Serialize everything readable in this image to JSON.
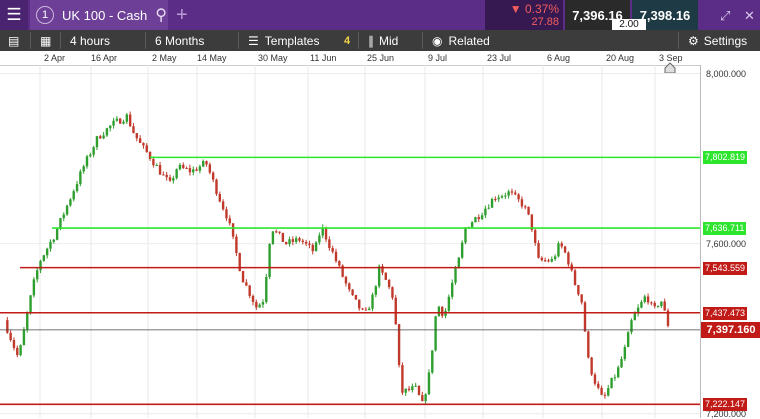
{
  "instrument": {
    "tab_number": "1",
    "name": "UK 100 - Cash"
  },
  "quote": {
    "change_pct": "▼ 0.37%",
    "change_abs": "27.88",
    "sell": "7,396.16",
    "buy": "7,398.16",
    "spread": "2.00"
  },
  "toolbar": {
    "interval": "4 hours",
    "range": "6 Months",
    "templates": "Templates",
    "templates_count": "4",
    "price_type": "Mid",
    "related": "Related",
    "settings": "Settings"
  },
  "icons": {
    "menu": "hamburger-icon",
    "search": "search-icon",
    "add": "plus-icon",
    "minimize": "minimize-icon",
    "close": "close-icon",
    "expand": "expand-icon"
  },
  "colors": {
    "header": "#5b2d86",
    "support": "#2ecc40",
    "resistance": "#c11b17",
    "bull": "#2e9e2e",
    "bear": "#c0392b"
  },
  "chart_data": {
    "type": "candlestick",
    "x_labels": [
      "2 Apr",
      "16 Apr",
      "2 May",
      "14 May",
      "30 May",
      "11 Jun",
      "25 Jun",
      "9 Jul",
      "23 Jul",
      "6 Aug",
      "20 Aug",
      "3 Sep"
    ],
    "y_ticks": [
      "8,000.000",
      "7,600.000",
      "7,200.000"
    ],
    "ylim": [
      7190,
      8020
    ],
    "current_price": "7,397.160",
    "current_value": 7397.16,
    "levels": [
      {
        "label": "7,802.819",
        "value": 7802.819,
        "color": "green"
      },
      {
        "label": "7,636.711",
        "value": 7636.711,
        "color": "green"
      },
      {
        "label": "7,543.559",
        "value": 7543.559,
        "color": "red"
      },
      {
        "label": "7,437.473",
        "value": 7437.473,
        "color": "red"
      },
      {
        "label": "7,222.147",
        "value": 7222.147,
        "color": "red"
      }
    ],
    "price_path": [
      [
        0,
        7420
      ],
      [
        2,
        7330
      ],
      [
        4,
        7500
      ],
      [
        5,
        7560
      ],
      [
        7,
        7620
      ],
      [
        9,
        7700
      ],
      [
        11,
        7780
      ],
      [
        13,
        7850
      ],
      [
        15,
        7880
      ],
      [
        17,
        7900
      ],
      [
        18,
        7860
      ],
      [
        19,
        7830
      ],
      [
        20,
        7810
      ],
      [
        22,
        7760
      ],
      [
        23,
        7740
      ],
      [
        24,
        7780
      ],
      [
        26,
        7770
      ],
      [
        28,
        7790
      ],
      [
        30,
        7700
      ],
      [
        31,
        7660
      ],
      [
        33,
        7520
      ],
      [
        35,
        7450
      ],
      [
        36,
        7470
      ],
      [
        37,
        7640
      ],
      [
        39,
        7600
      ],
      [
        41,
        7610
      ],
      [
        43,
        7580
      ],
      [
        44,
        7640
      ],
      [
        46,
        7560
      ],
      [
        48,
        7480
      ],
      [
        50,
        7430
      ],
      [
        51,
        7470
      ],
      [
        52,
        7540
      ],
      [
        53,
        7510
      ],
      [
        54,
        7470
      ],
      [
        55,
        7250
      ],
      [
        57,
        7260
      ],
      [
        58,
        7220
      ],
      [
        59,
        7300
      ],
      [
        60,
        7460
      ],
      [
        61,
        7430
      ],
      [
        62,
        7500
      ],
      [
        63,
        7560
      ],
      [
        64,
        7640
      ],
      [
        66,
        7670
      ],
      [
        68,
        7710
      ],
      [
        70,
        7720
      ],
      [
        72,
        7690
      ],
      [
        73,
        7650
      ],
      [
        74,
        7560
      ],
      [
        76,
        7560
      ],
      [
        77,
        7600
      ],
      [
        78,
        7570
      ],
      [
        79,
        7510
      ],
      [
        80,
        7470
      ],
      [
        81,
        7320
      ],
      [
        82,
        7270
      ],
      [
        83,
        7230
      ],
      [
        84,
        7270
      ],
      [
        85,
        7300
      ],
      [
        86,
        7350
      ],
      [
        87,
        7420
      ],
      [
        88,
        7450
      ],
      [
        89,
        7480
      ],
      [
        90,
        7440
      ],
      [
        91,
        7470
      ],
      [
        92,
        7410
      ]
    ]
  }
}
